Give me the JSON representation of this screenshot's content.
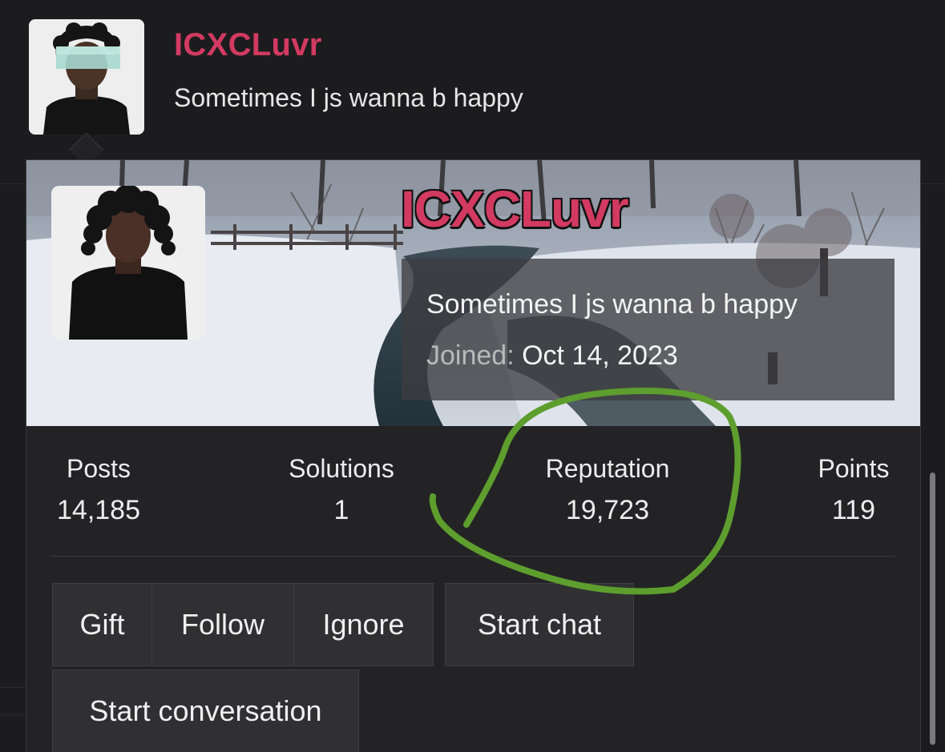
{
  "header": {
    "username": "ICXCLuvr",
    "status": "Sometimes I js wanna b happy"
  },
  "card": {
    "username": "ICXCLuvr",
    "status": "Sometimes I js wanna b happy",
    "joined_label": "Joined:",
    "joined_date": "Oct 14, 2023"
  },
  "stats": [
    {
      "label": "Posts",
      "value": "14,185"
    },
    {
      "label": "Solutions",
      "value": "1"
    },
    {
      "label": "Reputation",
      "value": "19,723"
    },
    {
      "label": "Points",
      "value": "119"
    }
  ],
  "actions": {
    "gift": "Gift",
    "follow": "Follow",
    "ignore": "Ignore",
    "start_chat": "Start chat",
    "start_conversation": "Start conversation"
  },
  "colors": {
    "username": "#d23a62",
    "annotation": "#5e9e2e",
    "background": "#1c1c1e"
  },
  "annotation": {
    "type": "hand-drawn circle",
    "highlights": "Reputation"
  }
}
